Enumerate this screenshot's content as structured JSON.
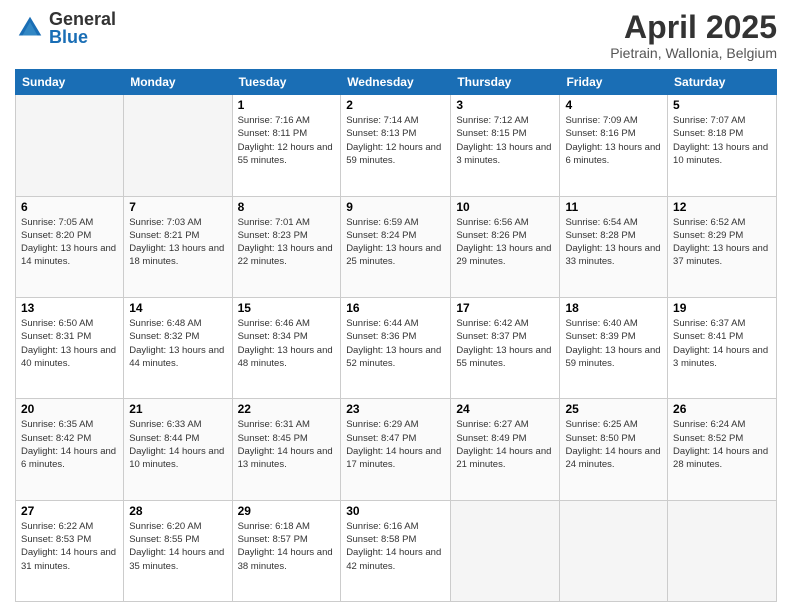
{
  "header": {
    "logo_general": "General",
    "logo_blue": "Blue",
    "month_title": "April 2025",
    "location": "Pietrain, Wallonia, Belgium"
  },
  "days_of_week": [
    "Sunday",
    "Monday",
    "Tuesday",
    "Wednesday",
    "Thursday",
    "Friday",
    "Saturday"
  ],
  "weeks": [
    [
      {
        "day": "",
        "sunrise": "",
        "sunset": "",
        "daylight": "",
        "empty": true
      },
      {
        "day": "",
        "sunrise": "",
        "sunset": "",
        "daylight": "",
        "empty": true
      },
      {
        "day": "1",
        "sunrise": "Sunrise: 7:16 AM",
        "sunset": "Sunset: 8:11 PM",
        "daylight": "Daylight: 12 hours and 55 minutes.",
        "empty": false
      },
      {
        "day": "2",
        "sunrise": "Sunrise: 7:14 AM",
        "sunset": "Sunset: 8:13 PM",
        "daylight": "Daylight: 12 hours and 59 minutes.",
        "empty": false
      },
      {
        "day": "3",
        "sunrise": "Sunrise: 7:12 AM",
        "sunset": "Sunset: 8:15 PM",
        "daylight": "Daylight: 13 hours and 3 minutes.",
        "empty": false
      },
      {
        "day": "4",
        "sunrise": "Sunrise: 7:09 AM",
        "sunset": "Sunset: 8:16 PM",
        "daylight": "Daylight: 13 hours and 6 minutes.",
        "empty": false
      },
      {
        "day": "5",
        "sunrise": "Sunrise: 7:07 AM",
        "sunset": "Sunset: 8:18 PM",
        "daylight": "Daylight: 13 hours and 10 minutes.",
        "empty": false
      }
    ],
    [
      {
        "day": "6",
        "sunrise": "Sunrise: 7:05 AM",
        "sunset": "Sunset: 8:20 PM",
        "daylight": "Daylight: 13 hours and 14 minutes.",
        "empty": false
      },
      {
        "day": "7",
        "sunrise": "Sunrise: 7:03 AM",
        "sunset": "Sunset: 8:21 PM",
        "daylight": "Daylight: 13 hours and 18 minutes.",
        "empty": false
      },
      {
        "day": "8",
        "sunrise": "Sunrise: 7:01 AM",
        "sunset": "Sunset: 8:23 PM",
        "daylight": "Daylight: 13 hours and 22 minutes.",
        "empty": false
      },
      {
        "day": "9",
        "sunrise": "Sunrise: 6:59 AM",
        "sunset": "Sunset: 8:24 PM",
        "daylight": "Daylight: 13 hours and 25 minutes.",
        "empty": false
      },
      {
        "day": "10",
        "sunrise": "Sunrise: 6:56 AM",
        "sunset": "Sunset: 8:26 PM",
        "daylight": "Daylight: 13 hours and 29 minutes.",
        "empty": false
      },
      {
        "day": "11",
        "sunrise": "Sunrise: 6:54 AM",
        "sunset": "Sunset: 8:28 PM",
        "daylight": "Daylight: 13 hours and 33 minutes.",
        "empty": false
      },
      {
        "day": "12",
        "sunrise": "Sunrise: 6:52 AM",
        "sunset": "Sunset: 8:29 PM",
        "daylight": "Daylight: 13 hours and 37 minutes.",
        "empty": false
      }
    ],
    [
      {
        "day": "13",
        "sunrise": "Sunrise: 6:50 AM",
        "sunset": "Sunset: 8:31 PM",
        "daylight": "Daylight: 13 hours and 40 minutes.",
        "empty": false
      },
      {
        "day": "14",
        "sunrise": "Sunrise: 6:48 AM",
        "sunset": "Sunset: 8:32 PM",
        "daylight": "Daylight: 13 hours and 44 minutes.",
        "empty": false
      },
      {
        "day": "15",
        "sunrise": "Sunrise: 6:46 AM",
        "sunset": "Sunset: 8:34 PM",
        "daylight": "Daylight: 13 hours and 48 minutes.",
        "empty": false
      },
      {
        "day": "16",
        "sunrise": "Sunrise: 6:44 AM",
        "sunset": "Sunset: 8:36 PM",
        "daylight": "Daylight: 13 hours and 52 minutes.",
        "empty": false
      },
      {
        "day": "17",
        "sunrise": "Sunrise: 6:42 AM",
        "sunset": "Sunset: 8:37 PM",
        "daylight": "Daylight: 13 hours and 55 minutes.",
        "empty": false
      },
      {
        "day": "18",
        "sunrise": "Sunrise: 6:40 AM",
        "sunset": "Sunset: 8:39 PM",
        "daylight": "Daylight: 13 hours and 59 minutes.",
        "empty": false
      },
      {
        "day": "19",
        "sunrise": "Sunrise: 6:37 AM",
        "sunset": "Sunset: 8:41 PM",
        "daylight": "Daylight: 14 hours and 3 minutes.",
        "empty": false
      }
    ],
    [
      {
        "day": "20",
        "sunrise": "Sunrise: 6:35 AM",
        "sunset": "Sunset: 8:42 PM",
        "daylight": "Daylight: 14 hours and 6 minutes.",
        "empty": false
      },
      {
        "day": "21",
        "sunrise": "Sunrise: 6:33 AM",
        "sunset": "Sunset: 8:44 PM",
        "daylight": "Daylight: 14 hours and 10 minutes.",
        "empty": false
      },
      {
        "day": "22",
        "sunrise": "Sunrise: 6:31 AM",
        "sunset": "Sunset: 8:45 PM",
        "daylight": "Daylight: 14 hours and 13 minutes.",
        "empty": false
      },
      {
        "day": "23",
        "sunrise": "Sunrise: 6:29 AM",
        "sunset": "Sunset: 8:47 PM",
        "daylight": "Daylight: 14 hours and 17 minutes.",
        "empty": false
      },
      {
        "day": "24",
        "sunrise": "Sunrise: 6:27 AM",
        "sunset": "Sunset: 8:49 PM",
        "daylight": "Daylight: 14 hours and 21 minutes.",
        "empty": false
      },
      {
        "day": "25",
        "sunrise": "Sunrise: 6:25 AM",
        "sunset": "Sunset: 8:50 PM",
        "daylight": "Daylight: 14 hours and 24 minutes.",
        "empty": false
      },
      {
        "day": "26",
        "sunrise": "Sunrise: 6:24 AM",
        "sunset": "Sunset: 8:52 PM",
        "daylight": "Daylight: 14 hours and 28 minutes.",
        "empty": false
      }
    ],
    [
      {
        "day": "27",
        "sunrise": "Sunrise: 6:22 AM",
        "sunset": "Sunset: 8:53 PM",
        "daylight": "Daylight: 14 hours and 31 minutes.",
        "empty": false
      },
      {
        "day": "28",
        "sunrise": "Sunrise: 6:20 AM",
        "sunset": "Sunset: 8:55 PM",
        "daylight": "Daylight: 14 hours and 35 minutes.",
        "empty": false
      },
      {
        "day": "29",
        "sunrise": "Sunrise: 6:18 AM",
        "sunset": "Sunset: 8:57 PM",
        "daylight": "Daylight: 14 hours and 38 minutes.",
        "empty": false
      },
      {
        "day": "30",
        "sunrise": "Sunrise: 6:16 AM",
        "sunset": "Sunset: 8:58 PM",
        "daylight": "Daylight: 14 hours and 42 minutes.",
        "empty": false
      },
      {
        "day": "",
        "sunrise": "",
        "sunset": "",
        "daylight": "",
        "empty": true
      },
      {
        "day": "",
        "sunrise": "",
        "sunset": "",
        "daylight": "",
        "empty": true
      },
      {
        "day": "",
        "sunrise": "",
        "sunset": "",
        "daylight": "",
        "empty": true
      }
    ]
  ]
}
